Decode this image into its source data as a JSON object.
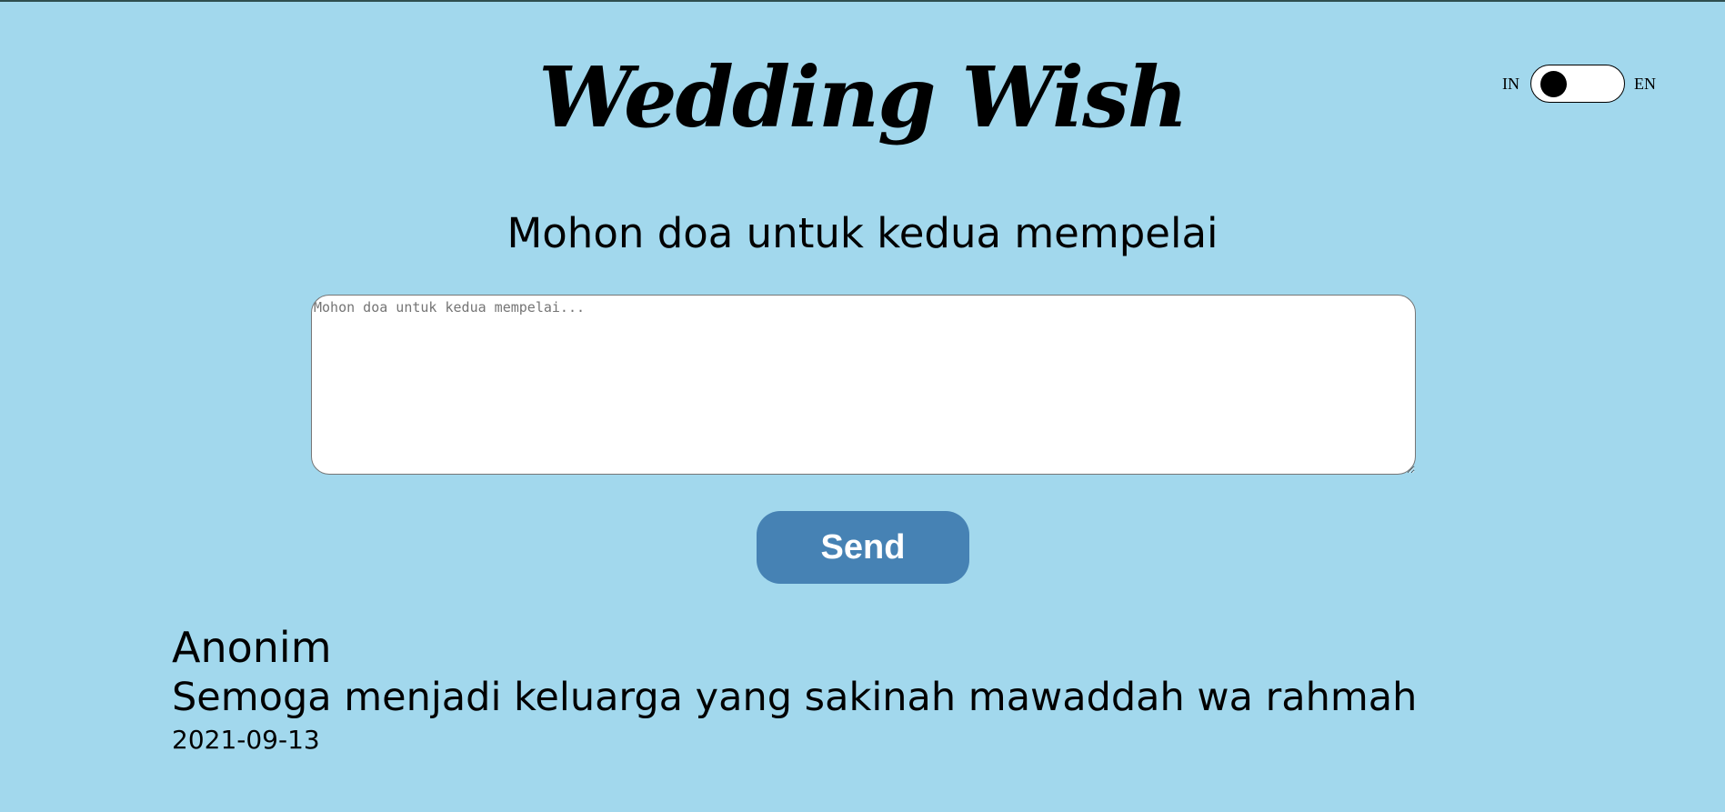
{
  "header": {
    "title": "Wedding Wish"
  },
  "language_toggle": {
    "left_label": "IN",
    "right_label": "EN",
    "selected": "IN"
  },
  "form": {
    "prompt": "Mohon doa untuk kedua mempelai",
    "placeholder": "Mohon doa untuk kedua mempelai...",
    "value": "",
    "send_label": "Send"
  },
  "wishes": [
    {
      "name": "Anonim",
      "message": "Semoga menjadi keluarga yang sakinah mawaddah wa rahmah",
      "date": "2021-09-13"
    }
  ],
  "colors": {
    "background": "#a2d8ed",
    "button": "#4682b4",
    "button_text": "#ffffff"
  }
}
